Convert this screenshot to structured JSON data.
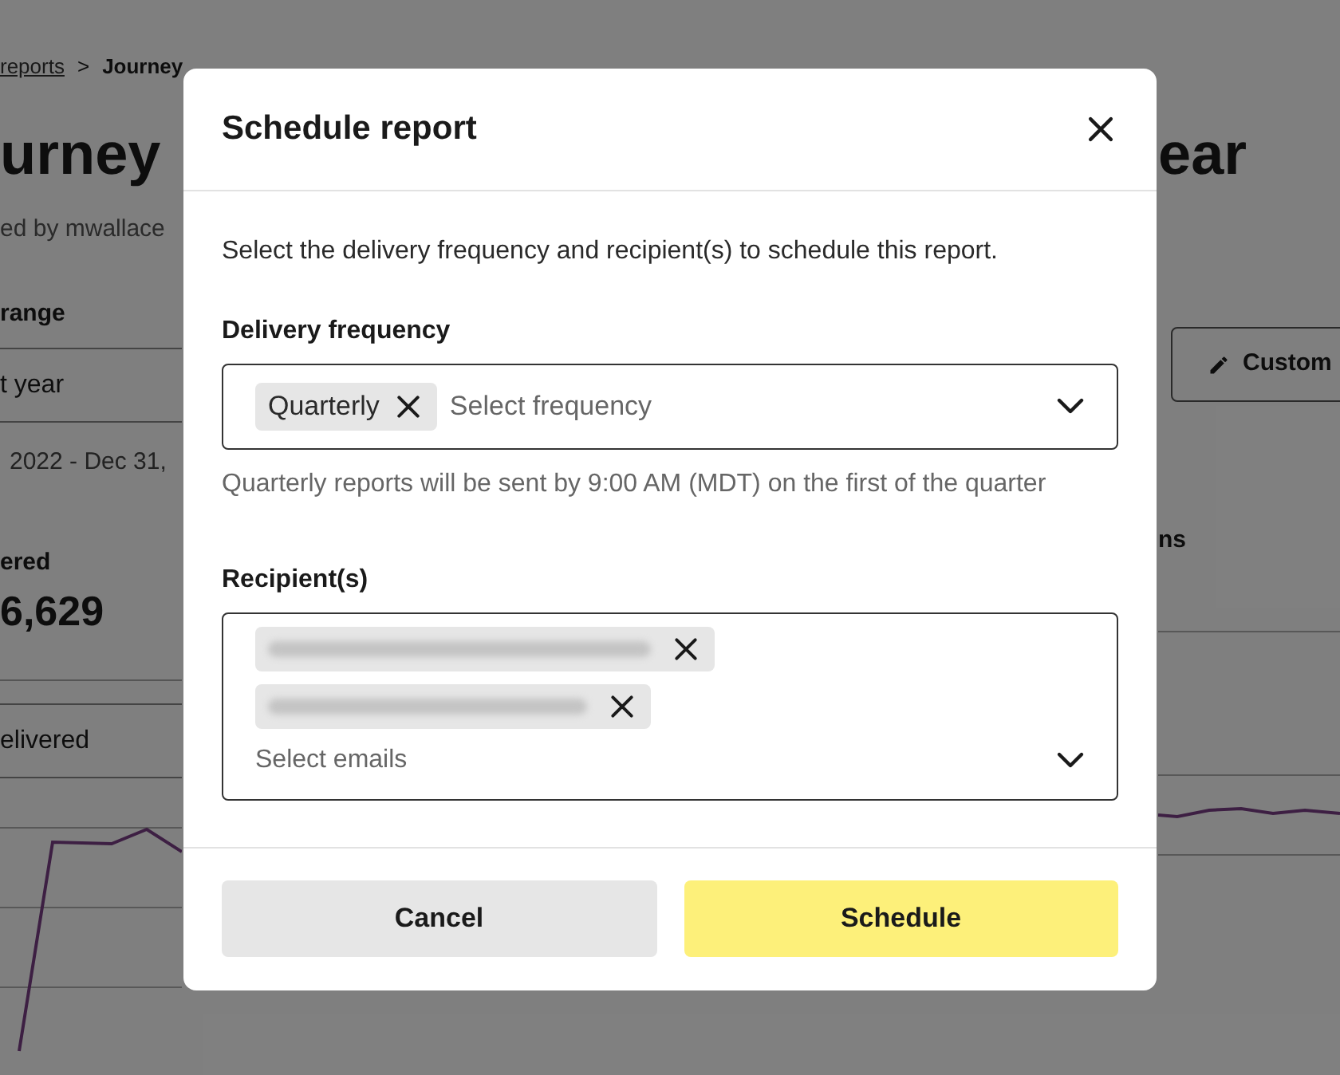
{
  "background": {
    "breadcrumb": {
      "link": "reports",
      "separator": ">",
      "current": "Journey"
    },
    "title_left": "urney",
    "title_right": "ear",
    "subtitle": "ed by mwallace",
    "range_label": "range",
    "range_value": "t year",
    "date_range": "2022 - Dec 31,",
    "stat_label": "ered",
    "stat_value": "6,629",
    "metric_select": "elivered",
    "custom_button": "Custom",
    "right_label": "ns"
  },
  "dialog": {
    "title": "Schedule report",
    "description": "Select the delivery frequency and recipient(s) to schedule this report.",
    "frequency": {
      "label": "Delivery frequency",
      "chips": [
        {
          "kind": "text",
          "label": "Quarterly"
        }
      ],
      "placeholder": "Select frequency",
      "helper": "Quarterly reports will be sent by 9:00 AM (MDT) on the first of the quarter"
    },
    "recipients": {
      "label": "Recipient(s)",
      "chips": [
        {
          "kind": "blurred"
        },
        {
          "kind": "blurred"
        }
      ],
      "placeholder": "Select emails"
    },
    "buttons": [
      {
        "kind": "secondary",
        "label": "Cancel"
      },
      {
        "kind": "primary",
        "label": "Schedule"
      }
    ]
  }
}
